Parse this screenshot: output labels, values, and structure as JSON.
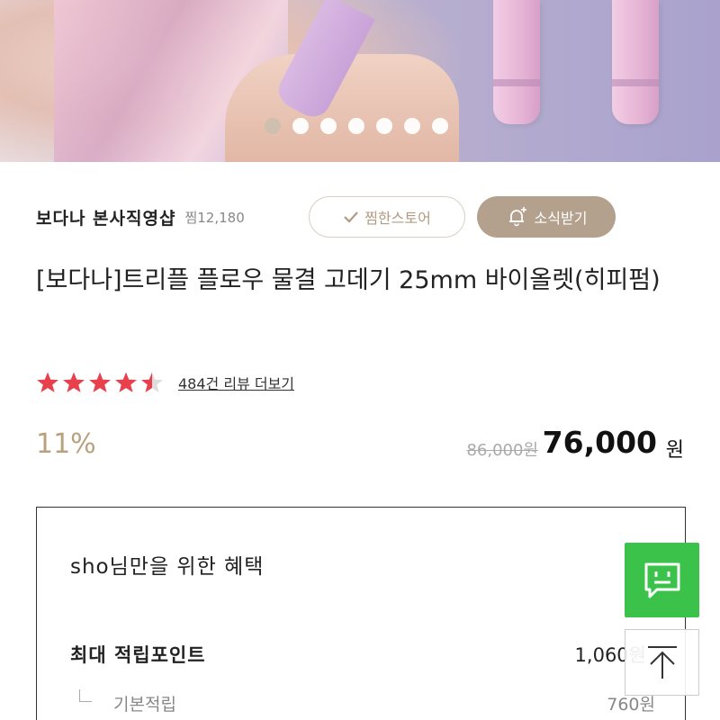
{
  "banner": {
    "slide_count": 7,
    "active_index": 0
  },
  "store": {
    "name": "보다나 본사직영샵",
    "wish_count": "찜12,180",
    "wish_store_label": "찜한스토어",
    "news_label": "소식받기"
  },
  "product": {
    "title": "[보다나]트리플 플로우 물결 고데기 25mm 바이올렛(히피펌)",
    "rating": 4.5,
    "rating_max": 5,
    "review_link": "484건 리뷰 더보기",
    "discount": "11%",
    "original_price": "86,000원",
    "final_price": "76,000",
    "currency": "원"
  },
  "benefit": {
    "title": "sho님만을 위한 혜택",
    "max_points_label": "최대 적립포인트",
    "max_points_value": "1,060원",
    "basic_label": "기본적립",
    "basic_value": "760원"
  },
  "colors": {
    "accent": "#b3a18d",
    "star": "#e8414d",
    "chat": "#3bc24a",
    "discount": "#b8a17e"
  },
  "icons": {
    "check": "check-icon",
    "bell_plus": "bell-plus-icon",
    "chat": "chat-icon",
    "scroll_top": "arrow-up-icon",
    "chevron": "chevron-down-icon"
  }
}
